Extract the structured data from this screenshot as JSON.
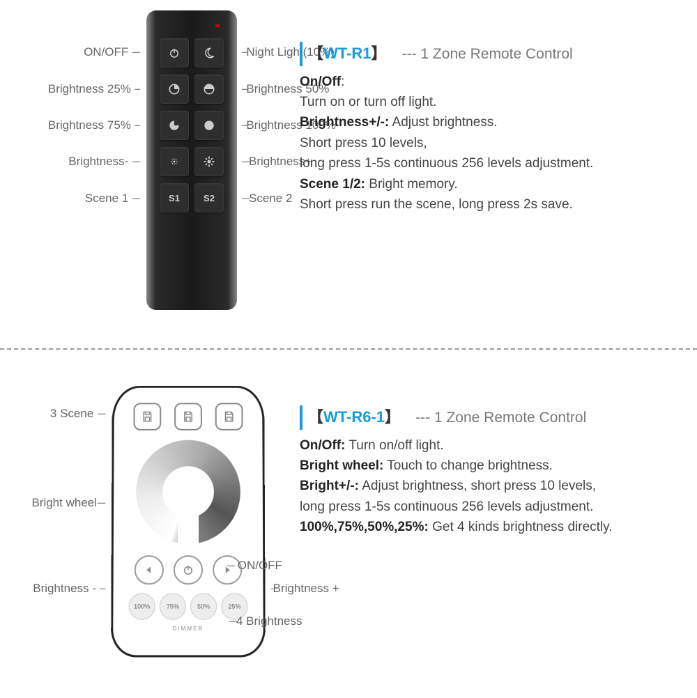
{
  "r1": {
    "model": "WT-R1",
    "subtitle": "--- 1 Zone Remote Control",
    "labels": {
      "onoff": "ON/OFF",
      "nightlight": "Night Light(10%)",
      "b25": "Brightness 25%",
      "b50": "Brightness 50%",
      "b75": "Brightness 75%",
      "b100": "Brightness 100%",
      "bminus": "Brightness-",
      "bplus": "Brightness+",
      "scene1": "Scene 1",
      "scene2": "Scene 2"
    },
    "buttons": {
      "s1": "S1",
      "s2": "S2"
    },
    "desc": {
      "onoff_h": "On/Off",
      "onoff_t": "Turn on or turn off light.",
      "bright_h": "Brightness+/-:",
      "bright_t1": "Adjust brightness.",
      "bright_t2": "Short press 10 levels,",
      "bright_t3": "long press 1-5s continuous 256 levels adjustment.",
      "scene_h": "Scene 1/2:",
      "scene_t1": "Bright memory.",
      "scene_t2": "Short press run the scene, long press 2s save."
    }
  },
  "r6": {
    "model": "WT-R6-1",
    "subtitle": "--- 1 Zone Remote Control",
    "labels": {
      "scene3": "3 Scene",
      "wheel": "Bright wheel",
      "onoff": "ON/OFF",
      "bminus": "Brightness -",
      "bplus": "Brightness +",
      "b4": "4 Brightness"
    },
    "pct": [
      "100%",
      "75%",
      "50%",
      "25%"
    ],
    "dimmer": "DIMMER",
    "desc": {
      "onoff_h": "On/Off:",
      "onoff_t": "Turn on/off light.",
      "wheel_h": "Bright wheel:",
      "wheel_t": "Touch to change brightness.",
      "bright_h": "Bright+/-:",
      "bright_t1": "Adjust brightness, short press 10 levels,",
      "bright_t2": "long press 1-5s continuous 256 levels adjustment.",
      "pct_h": "100%,75%,50%,25%:",
      "pct_t": "Get 4 kinds brightness directly."
    }
  }
}
